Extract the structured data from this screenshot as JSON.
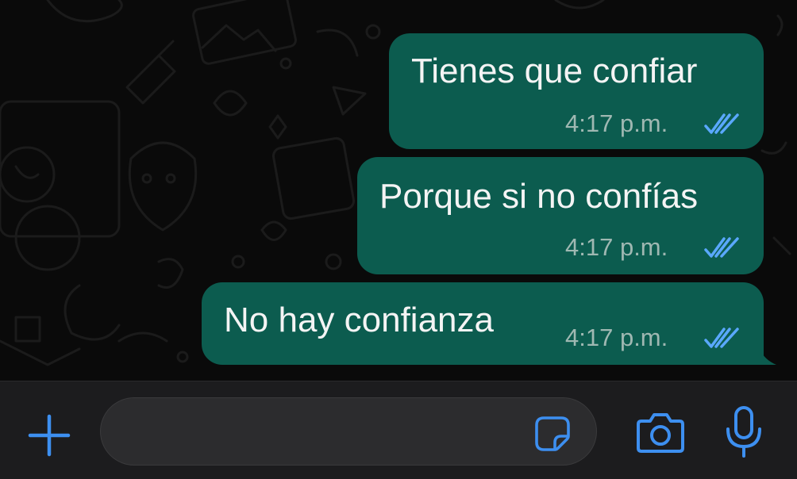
{
  "colors": {
    "accent": "#3d8ff0",
    "outgoing_bubble": "#0c5c4f",
    "read_ticks": "#5aa8ff",
    "background": "#0a0a0a",
    "input_bar": "#1c1c1e"
  },
  "messages": [
    {
      "text": "Tienes que confiar",
      "time": "4:17 p.m.",
      "status": "read",
      "status_icon": "double-check-icon"
    },
    {
      "text": "Porque si no confías",
      "time": "4:17 p.m.",
      "status": "read",
      "status_icon": "double-check-icon"
    },
    {
      "text": "No hay confianza",
      "time": "4:17 p.m.",
      "status": "read",
      "status_icon": "double-check-icon"
    }
  ],
  "composer": {
    "value": "",
    "placeholder": "",
    "icons": {
      "attach": "plus-icon",
      "sticker": "sticker-icon",
      "camera": "camera-icon",
      "microphone": "microphone-icon"
    }
  }
}
